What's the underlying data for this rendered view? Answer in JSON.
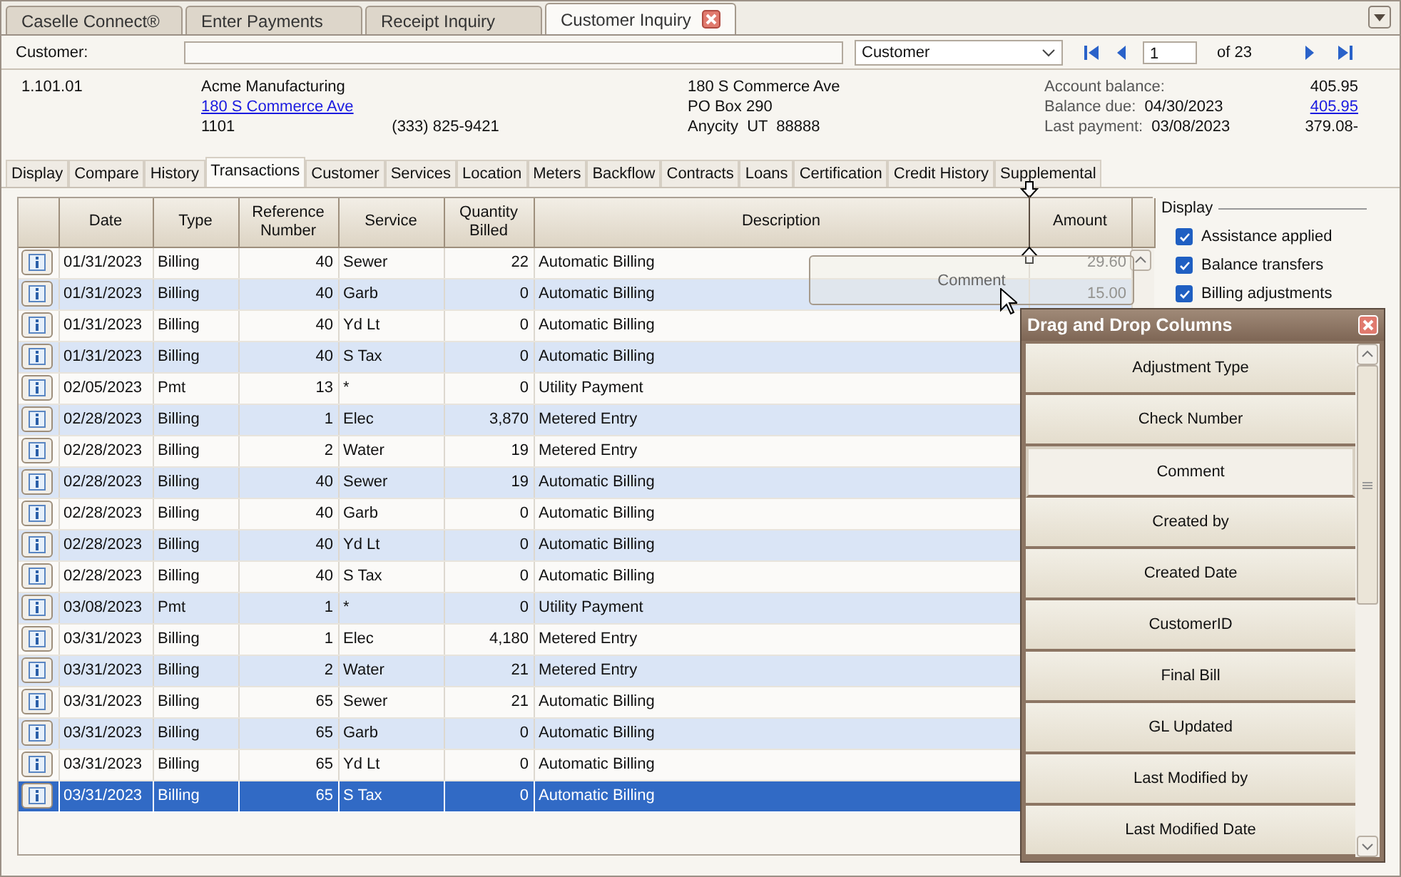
{
  "app_tabs": [
    {
      "label": "Caselle Connect®",
      "selected": false,
      "closable": false
    },
    {
      "label": "Enter Payments",
      "selected": false,
      "closable": false
    },
    {
      "label": "Receipt Inquiry",
      "selected": false,
      "closable": false
    },
    {
      "label": "Customer Inquiry",
      "selected": true,
      "closable": true
    }
  ],
  "customer_bar": {
    "label": "Customer:",
    "lookup_by": "Customer",
    "record": "1",
    "of": "of 23"
  },
  "info": {
    "account": "1.101.01",
    "name": "Acme Manufacturing",
    "address_link": "180 S Commerce Ave",
    "code": "1101",
    "phone": "(333) 825-9421",
    "mailing": [
      "180 S Commerce Ave",
      "PO Box 290",
      "Anycity  UT  88888"
    ],
    "balances": [
      {
        "label": "Account balance:",
        "value": "405.95",
        "link": false
      },
      {
        "label": "Balance due:",
        "date": "04/30/2023",
        "value": "405.95",
        "link": true
      },
      {
        "label": "Last payment:",
        "date": "03/08/2023",
        "value": "379.08-",
        "link": false
      }
    ]
  },
  "sub_tabs": [
    {
      "label": "Display",
      "selected": false
    },
    {
      "label": "Compare",
      "selected": false
    },
    {
      "label": "History",
      "selected": false
    },
    {
      "label": "Transactions",
      "selected": true
    },
    {
      "label": "Customer",
      "selected": false
    },
    {
      "label": "Services",
      "selected": false
    },
    {
      "label": "Location",
      "selected": false
    },
    {
      "label": "Meters",
      "selected": false
    },
    {
      "label": "Backflow",
      "selected": false
    },
    {
      "label": "Contracts",
      "selected": false
    },
    {
      "label": "Loans",
      "selected": false
    },
    {
      "label": "Certification",
      "selected": false
    },
    {
      "label": "Credit History",
      "selected": false
    },
    {
      "label": "Supplemental",
      "selected": false
    }
  ],
  "grid": {
    "columns": [
      "Date",
      "Type",
      "Reference Number",
      "Service",
      "Quantity Billed",
      "Description",
      "Amount"
    ],
    "rows": [
      {
        "date": "01/31/2023",
        "type": "Billing",
        "ref": "40",
        "service": "Sewer",
        "qty": "22",
        "desc": "Automatic Billing",
        "amount": "29.60",
        "selected": false
      },
      {
        "date": "01/31/2023",
        "type": "Billing",
        "ref": "40",
        "service": "Garb",
        "qty": "0",
        "desc": "Automatic Billing",
        "amount": "15.00",
        "selected": false
      },
      {
        "date": "01/31/2023",
        "type": "Billing",
        "ref": "40",
        "service": "Yd Lt",
        "qty": "0",
        "desc": "Automatic Billing",
        "selected": false
      },
      {
        "date": "01/31/2023",
        "type": "Billing",
        "ref": "40",
        "service": "S Tax",
        "qty": "0",
        "desc": "Automatic Billing",
        "selected": false
      },
      {
        "date": "02/05/2023",
        "type": "Pmt",
        "ref": "13",
        "service": "*",
        "qty": "0",
        "desc": "Utility Payment",
        "selected": false
      },
      {
        "date": "02/28/2023",
        "type": "Billing",
        "ref": "1",
        "service": "Elec",
        "qty": "3,870",
        "desc": "Metered Entry",
        "selected": false
      },
      {
        "date": "02/28/2023",
        "type": "Billing",
        "ref": "2",
        "service": "Water",
        "qty": "19",
        "desc": "Metered Entry",
        "selected": false
      },
      {
        "date": "02/28/2023",
        "type": "Billing",
        "ref": "40",
        "service": "Sewer",
        "qty": "19",
        "desc": "Automatic Billing",
        "selected": false
      },
      {
        "date": "02/28/2023",
        "type": "Billing",
        "ref": "40",
        "service": "Garb",
        "qty": "0",
        "desc": "Automatic Billing",
        "selected": false
      },
      {
        "date": "02/28/2023",
        "type": "Billing",
        "ref": "40",
        "service": "Yd Lt",
        "qty": "0",
        "desc": "Automatic Billing",
        "selected": false
      },
      {
        "date": "02/28/2023",
        "type": "Billing",
        "ref": "40",
        "service": "S Tax",
        "qty": "0",
        "desc": "Automatic Billing",
        "selected": false
      },
      {
        "date": "03/08/2023",
        "type": "Pmt",
        "ref": "1",
        "service": "*",
        "qty": "0",
        "desc": "Utility Payment",
        "selected": false
      },
      {
        "date": "03/31/2023",
        "type": "Billing",
        "ref": "1",
        "service": "Elec",
        "qty": "4,180",
        "desc": "Metered Entry",
        "selected": false
      },
      {
        "date": "03/31/2023",
        "type": "Billing",
        "ref": "2",
        "service": "Water",
        "qty": "21",
        "desc": "Metered Entry",
        "selected": false
      },
      {
        "date": "03/31/2023",
        "type": "Billing",
        "ref": "65",
        "service": "Sewer",
        "qty": "21",
        "desc": "Automatic Billing",
        "selected": false
      },
      {
        "date": "03/31/2023",
        "type": "Billing",
        "ref": "65",
        "service": "Garb",
        "qty": "0",
        "desc": "Automatic Billing",
        "selected": false
      },
      {
        "date": "03/31/2023",
        "type": "Billing",
        "ref": "65",
        "service": "Yd Lt",
        "qty": "0",
        "desc": "Automatic Billing",
        "selected": false
      },
      {
        "date": "03/31/2023",
        "type": "Billing",
        "ref": "65",
        "service": "S Tax",
        "qty": "0",
        "desc": "Automatic Billing",
        "selected": true
      }
    ]
  },
  "display_panel": {
    "title": "Display",
    "options": [
      {
        "label": "Assistance applied",
        "checked": true
      },
      {
        "label": "Balance transfers",
        "checked": true
      },
      {
        "label": "Billing adjustments",
        "checked": true
      }
    ]
  },
  "drag_ghost": {
    "label": "Comment"
  },
  "drag_drop_panel": {
    "title": "Drag and Drop Columns",
    "items": [
      {
        "label": "Adjustment Type",
        "selected": false
      },
      {
        "label": "Check Number",
        "selected": false
      },
      {
        "label": "Comment",
        "selected": true
      },
      {
        "label": "Created by",
        "selected": false
      },
      {
        "label": "Created Date",
        "selected": false
      },
      {
        "label": "CustomerID",
        "selected": false
      },
      {
        "label": "Final Bill",
        "selected": false
      },
      {
        "label": "GL Updated",
        "selected": false
      },
      {
        "label": "Last Modified by",
        "selected": false
      },
      {
        "label": "Last Modified Date",
        "selected": false
      }
    ]
  }
}
